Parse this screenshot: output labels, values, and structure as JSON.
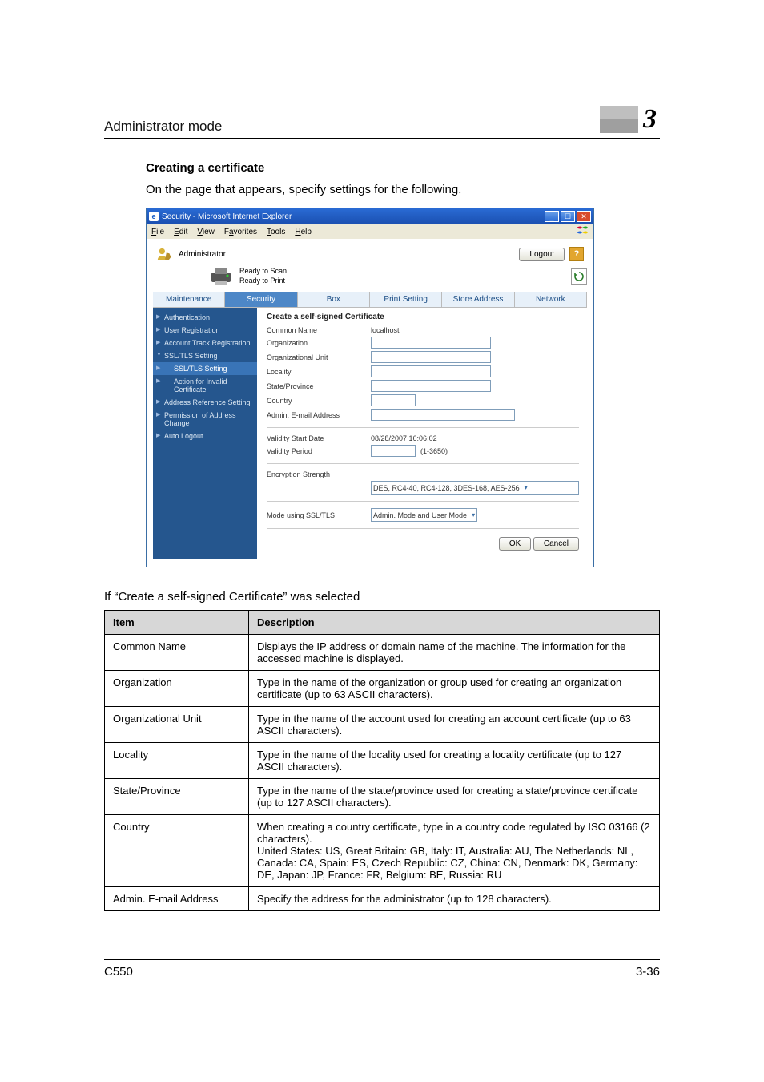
{
  "header": {
    "breadcrumb": "Administrator mode",
    "chapter": "3"
  },
  "section": {
    "title": "Creating a certificate",
    "desc": "On the page that appears, specify settings for the following."
  },
  "ie": {
    "title": "Security - Microsoft Internet Explorer",
    "menu": {
      "file": "File",
      "edit": "Edit",
      "view": "View",
      "favorites": "Favorites",
      "tools": "Tools",
      "help": "Help"
    },
    "admin_label": "Administrator",
    "logout": "Logout",
    "status1": "Ready to Scan",
    "status2": "Ready to Print",
    "help": "?",
    "tabs": {
      "maintenance": "Maintenance",
      "security": "Security",
      "box": "Box",
      "print": "Print Setting",
      "store": "Store Address",
      "network": "Network"
    },
    "sidebar": {
      "auth": "Authentication",
      "user": "User Registration",
      "acct": "Account Track Registration",
      "ssl": "SSL/TLS Setting",
      "ssl_setting": "SSL/TLS Setting",
      "action_invalid": "Action for Invalid Certificate",
      "addr_ref": "Address Reference Setting",
      "perm": "Permission of Address Change",
      "auto_logout": "Auto Logout"
    },
    "form": {
      "title": "Create a self-signed Certificate",
      "common_name": "Common Name",
      "common_name_val": "localhost",
      "org": "Organization",
      "org_unit": "Organizational Unit",
      "locality": "Locality",
      "state": "State/Province",
      "country": "Country",
      "admin_email": "Admin. E-mail Address",
      "valid_start": "Validity Start Date",
      "valid_start_val": "08/28/2007 16:06:02",
      "valid_period": "Validity Period",
      "valid_period_suffix": "(1-3650)",
      "enc": "Encryption Strength",
      "enc_sel": "DES, RC4-40, RC4-128, 3DES-168, AES-256",
      "mode": "Mode using SSL/TLS",
      "mode_sel": "Admin. Mode and User Mode",
      "ok": "OK",
      "cancel": "Cancel"
    }
  },
  "table_note": "If “Create a self-signed Certificate” was selected",
  "table": {
    "h1": "Item",
    "h2": "Description",
    "rows": [
      {
        "item": "Common Name",
        "desc": "Displays the IP address or domain name of the machine. The information for the accessed machine is displayed."
      },
      {
        "item": "Organization",
        "desc": "Type in the name of the organization or group used for creating an organization certificate (up to 63 ASCII characters)."
      },
      {
        "item": "Organizational Unit",
        "desc": "Type in the name of the account used for creating an account certificate (up to 63 ASCII characters)."
      },
      {
        "item": "Locality",
        "desc": "Type in the name of the locality used for creating a locality certificate (up to 127 ASCII characters)."
      },
      {
        "item": "State/Province",
        "desc": "Type in the name of the state/province used for creating a state/province certificate (up to 127 ASCII characters)."
      },
      {
        "item": "Country",
        "desc": "When creating a country certificate, type in a country code regulated by ISO 03166 (2 characters).\nUnited States: US, Great Britain: GB, Italy: IT, Australia: AU, The Netherlands: NL, Canada: CA, Spain: ES, Czech Republic: CZ, China: CN, Denmark: DK, Germany: DE, Japan: JP, France: FR, Belgium: BE, Russia: RU"
      },
      {
        "item": "Admin. E-mail Address",
        "desc": "Specify the address for the administrator (up to 128 characters)."
      }
    ]
  },
  "footer": {
    "left": "C550",
    "right": "3-36"
  }
}
